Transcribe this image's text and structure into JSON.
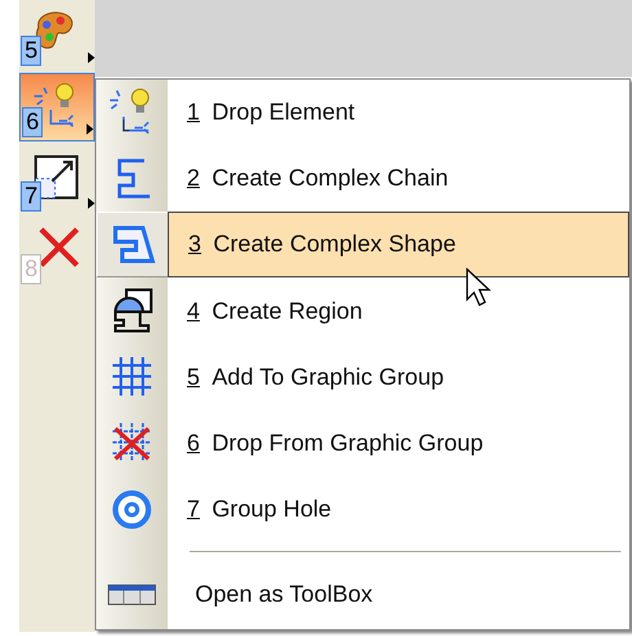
{
  "toolbar": [
    {
      "number": "5",
      "selected": false,
      "disabled": false,
      "has_menu": true
    },
    {
      "number": "6",
      "selected": true,
      "disabled": false,
      "has_menu": true
    },
    {
      "number": "7",
      "selected": false,
      "disabled": false,
      "has_menu": true
    },
    {
      "number": "8",
      "selected": false,
      "disabled": true,
      "has_menu": false
    }
  ],
  "menu": [
    {
      "kind": "item",
      "number": "1",
      "label": "Drop Element",
      "selected": false
    },
    {
      "kind": "item",
      "number": "2",
      "label": "Create Complex Chain",
      "selected": false
    },
    {
      "kind": "item",
      "number": "3",
      "label": "Create Complex Shape",
      "selected": true
    },
    {
      "kind": "item",
      "number": "4",
      "label": "Create Region",
      "selected": false
    },
    {
      "kind": "item",
      "number": "5",
      "label": "Add To Graphic Group",
      "selected": false
    },
    {
      "kind": "item",
      "number": "6",
      "label": "Drop From Graphic Group",
      "selected": false
    },
    {
      "kind": "item",
      "number": "7",
      "label": "Group Hole",
      "selected": false
    },
    {
      "kind": "separator"
    },
    {
      "kind": "toolbox",
      "label": "Open as ToolBox"
    }
  ]
}
